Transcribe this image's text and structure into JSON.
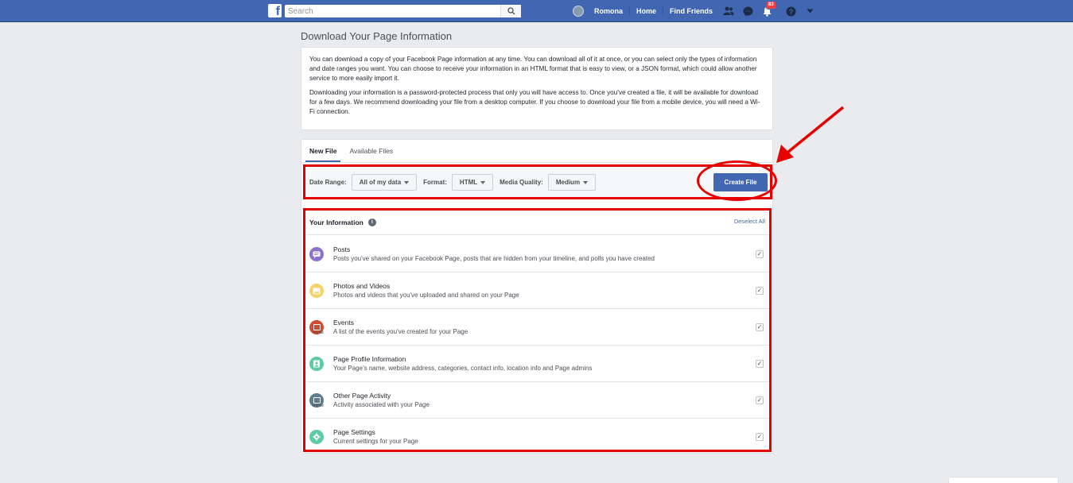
{
  "header": {
    "logo_letter": "f",
    "search_placeholder": "Search",
    "user_name": "Romona",
    "nav_links": [
      "Home",
      "Find Friends"
    ],
    "notification_count": "83"
  },
  "page": {
    "title": "Download Your Page Information",
    "intro_paragraph_1": "You can download a copy of your Facebook Page information at any time. You can download all of it at once, or you can select only the types of information and date ranges you want. You can choose to receive your information in an HTML format that is easy to view, or a JSON format, which could allow another service to more easily import it.",
    "intro_paragraph_2": "Downloading your information is a password-protected process that only you will have access to. Once you've created a file, it will be available for download for a few days. We recommend downloading your file from a desktop computer. If you choose to download your file from a mobile device, you will need a Wi-Fi connection."
  },
  "tabs": [
    "New File",
    "Available Files"
  ],
  "options": {
    "date_range_label": "Date Range:",
    "date_range_value": "All of my data",
    "format_label": "Format:",
    "format_value": "HTML",
    "media_quality_label": "Media Quality:",
    "media_quality_value": "Medium",
    "create_button": "Create File"
  },
  "info": {
    "header": "Your Information",
    "info_glyph": "i",
    "deselect_all": "Deselect All",
    "items": [
      {
        "title": "Posts",
        "desc": "Posts you've shared on your Facebook Page, posts that are hidden from your timeline, and polls you have created",
        "color": "#8c72cb",
        "invite": ""
      },
      {
        "title": "Photos and Videos",
        "desc": "Photos and videos that you've uploaded and shared on your Page",
        "color": "#f7d26a",
        "invite": ""
      },
      {
        "title": "Events",
        "desc": "A list of the events you've created for your Page",
        "color": "#d14a32",
        "invite": "invite"
      },
      {
        "title": "Page Profile Information",
        "desc": "Your Page's name, website address, categories, contact info, location info and Page admins",
        "color": "#5fcaa8",
        "invite": ""
      },
      {
        "title": "Other Page Activity",
        "desc": "Activity associated with your Page",
        "color": "#5e7d8e",
        "invite": "invite"
      },
      {
        "title": "Page Settings",
        "desc": "Current settings for your Page",
        "color": "#5fcaa8",
        "invite": ""
      }
    ],
    "check_glyph": "✓"
  },
  "colors": {
    "brand_blue": "#4267b2",
    "annotation_red": "#e60000"
  }
}
